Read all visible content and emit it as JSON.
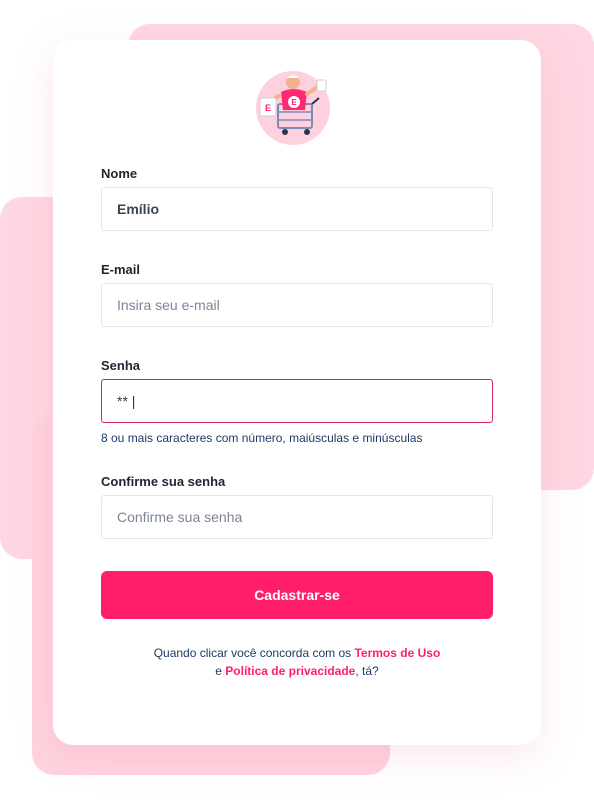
{
  "form": {
    "name": {
      "label": "Nome",
      "value": "Emílio",
      "placeholder": ""
    },
    "email": {
      "label": "E-mail",
      "value": "",
      "placeholder": "Insira seu e-mail"
    },
    "password": {
      "label": "Senha",
      "value": "** |",
      "hint": "8 ou mais caracteres com número, maiúsculas e minúsculas"
    },
    "confirm": {
      "label": "Confirme sua senha",
      "value": "",
      "placeholder": "Confirme sua senha"
    },
    "submit_label": "Cadastrar-se"
  },
  "terms": {
    "prefix": "Quando clicar você concorda com os ",
    "terms_link": "Termos de Uso",
    "connector": "e ",
    "privacy_link": "Política de privacidade",
    "suffix": ", tá?"
  },
  "colors": {
    "accent": "#ff1d6c",
    "background_shapes": "#ffd7e2",
    "focus_border": "#d6246e"
  },
  "logo": {
    "icon": "shopping-cart-mascot-icon",
    "badge_letter": "E"
  }
}
